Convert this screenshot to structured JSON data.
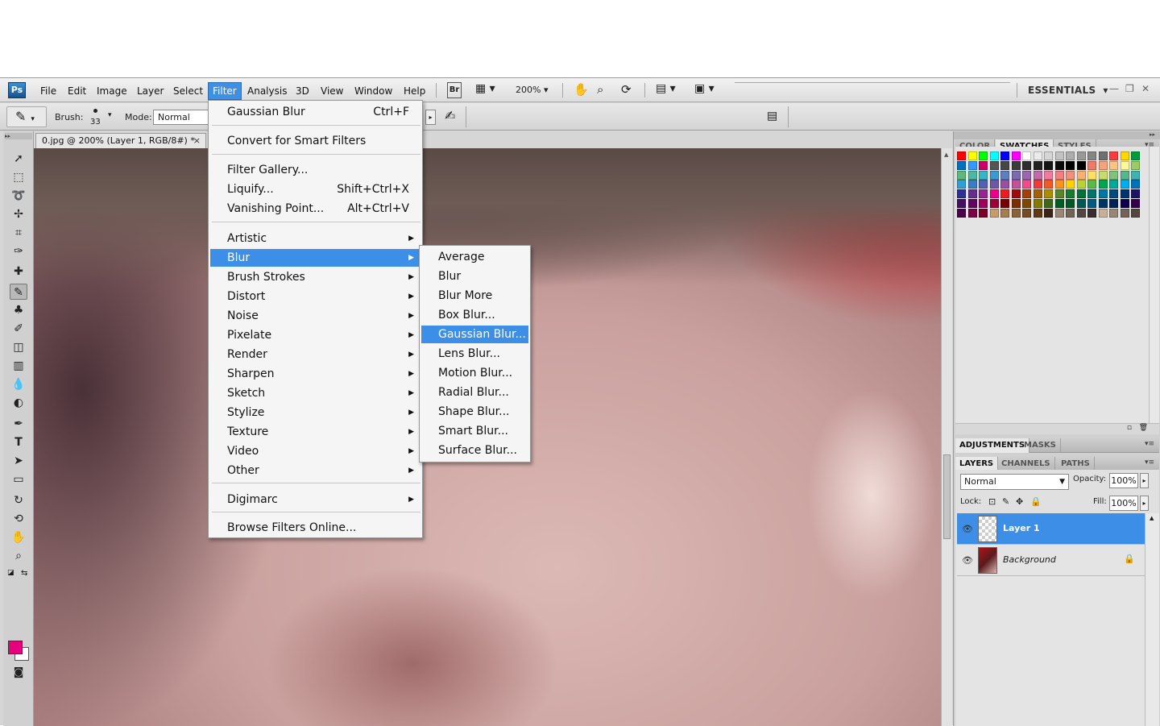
{
  "app": {
    "logo": "Ps"
  },
  "menubar": {
    "items": [
      "File",
      "Edit",
      "Image",
      "Layer",
      "Select",
      "Filter",
      "Analysis",
      "3D",
      "View",
      "Window",
      "Help"
    ],
    "active": "Filter",
    "bridge_label": "Br",
    "zoom": "200%",
    "workspace": "ESSENTIALS"
  },
  "options": {
    "brush_label": "Brush:",
    "brush_size": "33",
    "mode_label": "Mode:",
    "mode_value": "Normal"
  },
  "document": {
    "tab_title": "0.jpg @ 200% (Layer 1, RGB/8#) *",
    "close_glyph": "×"
  },
  "filter_menu": {
    "last_filter": {
      "label": "Gaussian Blur",
      "shortcut": "Ctrl+F"
    },
    "smart_filters": "Convert for Smart Filters",
    "filter_gallery": "Filter Gallery...",
    "liquify": {
      "label": "Liquify...",
      "shortcut": "Shift+Ctrl+X"
    },
    "vanishing_point": {
      "label": "Vanishing Point...",
      "shortcut": "Alt+Ctrl+V"
    },
    "groups": [
      "Artistic",
      "Blur",
      "Brush Strokes",
      "Distort",
      "Noise",
      "Pixelate",
      "Render",
      "Sharpen",
      "Sketch",
      "Stylize",
      "Texture",
      "Video",
      "Other"
    ],
    "digimarc": "Digimarc",
    "browse": "Browse Filters Online...",
    "highlighted": "Blur"
  },
  "blur_submenu": {
    "items": [
      "Average",
      "Blur",
      "Blur More",
      "Box Blur...",
      "Gaussian Blur...",
      "Lens Blur...",
      "Motion Blur...",
      "Radial Blur...",
      "Shape Blur...",
      "Smart Blur...",
      "Surface Blur..."
    ],
    "highlighted": "Gaussian Blur..."
  },
  "panels": {
    "color_tabs": [
      "COLOR",
      "SWATCHES",
      "STYLES"
    ],
    "color_active": "SWATCHES",
    "adj_tabs": [
      "ADJUSTMENTS",
      "MASKS"
    ],
    "layer_tabs": [
      "LAYERS",
      "CHANNELS",
      "PATHS"
    ],
    "layers_active": "LAYERS",
    "blend_mode": "Normal",
    "opacity_label": "Opacity:",
    "opacity": "100%",
    "lock_label": "Lock:",
    "fill_label": "Fill:",
    "fill": "100%",
    "layers": [
      {
        "name": "Layer 1",
        "selected": true
      },
      {
        "name": "Background",
        "selected": false
      }
    ]
  },
  "colors": {
    "foreground": "#e6007e",
    "accent": "#3d8ee6"
  },
  "swatches": [
    "#ff0000",
    "#ffff00",
    "#00ff00",
    "#00ffff",
    "#0000ff",
    "#ff00ff",
    "#ffffff",
    "#ebebeb",
    "#d6d6d6",
    "#c2c2c2",
    "#adadad",
    "#999999",
    "#858585",
    "#707070",
    "#ff3b3b",
    "#ffd800",
    "#009c3b",
    "#0070c0",
    "#3399ff",
    "#cc0066",
    "#545454",
    "#474747",
    "#3b3b3b",
    "#2e2e2e",
    "#222222",
    "#151515",
    "#0a0a0a",
    "#000000",
    "#000000",
    "#ed7b6a",
    "#f4a37a",
    "#f8c483",
    "#fff799",
    "#99cc66",
    "#5fb87a",
    "#4fb8a0",
    "#38b6c6",
    "#3d9ad1",
    "#5f7fc2",
    "#7a6bb3",
    "#9a67b0",
    "#c36ba8",
    "#f07aa0",
    "#f37f7f",
    "#f3907a",
    "#f9b072",
    "#ffe066",
    "#c8dc6c",
    "#7ec47a",
    "#56b78b",
    "#3fb3b2",
    "#2f9fd4",
    "#3b7cc3",
    "#5362ae",
    "#7156a4",
    "#9652a0",
    "#c2529a",
    "#ee4d8c",
    "#ee3b3b",
    "#f15a24",
    "#f7931e",
    "#ffd200",
    "#b5d334",
    "#5bb947",
    "#00a651",
    "#00a99d",
    "#00aeef",
    "#0072bc",
    "#2e3192",
    "#662d91",
    "#92278f",
    "#ec008c",
    "#ed1c24",
    "#9e0b0f",
    "#a0410d",
    "#a36209",
    "#ab8e00",
    "#598527",
    "#197b30",
    "#007236",
    "#00746b",
    "#0076a3",
    "#004a80",
    "#003471",
    "#1b1464",
    "#440e62",
    "#630460",
    "#9e005d",
    "#9e0039",
    "#790000",
    "#7b2e00",
    "#7d4900",
    "#827b00",
    "#406618",
    "#005e20",
    "#005826",
    "#005952",
    "#005b7f",
    "#003663",
    "#002157",
    "#0d004c",
    "#32004b",
    "#4b0049",
    "#7b0046",
    "#7a0026",
    "#c69c6d",
    "#a67c52",
    "#8c6239",
    "#754c24",
    "#603913",
    "#3c2415",
    "#998675",
    "#736357",
    "#534741",
    "#362f2d",
    "#c7b299",
    "#998675",
    "#736357",
    "#534741"
  ]
}
